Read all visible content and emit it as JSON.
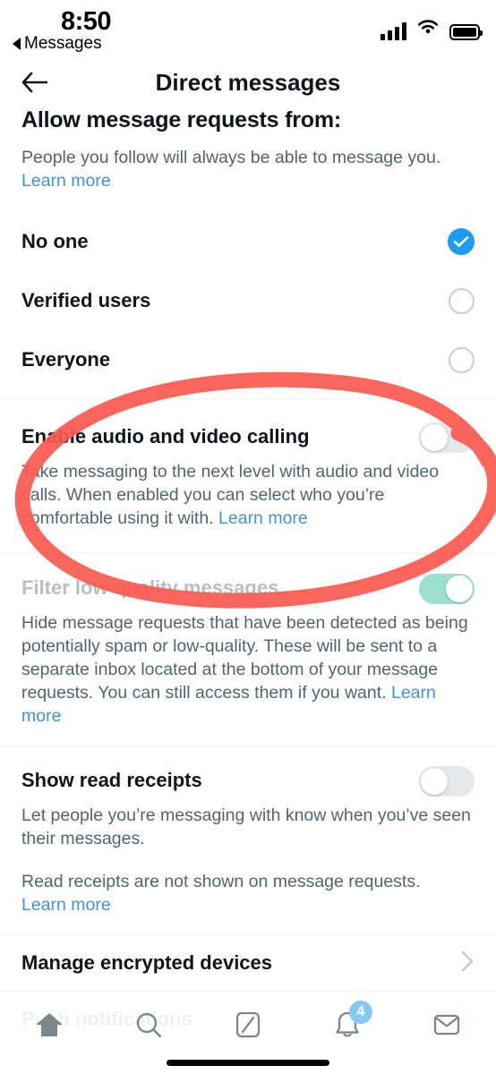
{
  "status_bar": {
    "time": "8:50",
    "return_label": "Messages",
    "signal_icon": "cellular-signal-icon",
    "wifi_icon": "wifi-icon",
    "battery_icon": "battery-full-icon"
  },
  "nav": {
    "back_icon": "back-arrow-icon",
    "title": "Direct messages"
  },
  "message_requests": {
    "heading": "Allow message requests from:",
    "description": "People you follow will always be able to message you.",
    "learn_more": "Learn more",
    "options": [
      {
        "label": "No one",
        "selected": true
      },
      {
        "label": "Verified users",
        "selected": false
      },
      {
        "label": "Everyone",
        "selected": false
      }
    ]
  },
  "calling": {
    "title": "Enable audio and video calling",
    "description": "Take messaging to the next level with audio and video calls. When enabled you can select who you’re comfortable using it with.",
    "learn_more": "Learn more",
    "toggle_state": "off"
  },
  "filter": {
    "title": "Filter low-quality messages",
    "description": "Hide message requests that have been detected as being potentially spam or low-quality. These will be sent to a separate inbox located at the bottom of your message requests. You can still access them if you want.",
    "learn_more": "Learn more",
    "toggle_state": "on",
    "disabled": true
  },
  "read_receipts": {
    "title": "Show read receipts",
    "description": "Let people you’re messaging with know when you’ve seen their messages.",
    "note": "Read receipts are not shown on message requests.",
    "learn_more": "Learn more",
    "toggle_state": "off"
  },
  "encrypted_devices": {
    "label": "Manage encrypted devices",
    "chevron_icon": "chevron-right-icon"
  },
  "push_notifications": {
    "label": "Push notifications",
    "chevron_icon": "chevron-right-icon"
  },
  "annotation": {
    "shape": "hand-drawn-ellipse",
    "color": "#fb5a50",
    "target": "Enable audio and video calling"
  },
  "tab_bar": {
    "items": [
      {
        "name": "home",
        "icon": "home-icon",
        "active": true,
        "badge": null
      },
      {
        "name": "search",
        "icon": "search-icon",
        "active": false,
        "badge": null
      },
      {
        "name": "compose",
        "icon": "compose-icon",
        "active": false,
        "badge": null
      },
      {
        "name": "notifications",
        "icon": "bell-icon",
        "active": false,
        "badge": "4"
      },
      {
        "name": "messages",
        "icon": "envelope-icon",
        "active": false,
        "badge": null
      }
    ]
  },
  "colors": {
    "accent_blue": "#1d9bf0",
    "link_blue": "#3f93d1",
    "toggle_on_green": "#9edfd0",
    "toggle_off_grey": "#e5e8ea",
    "annotation_red": "#fb5a50",
    "text_primary": "#0f1419",
    "text_secondary": "#536471"
  }
}
